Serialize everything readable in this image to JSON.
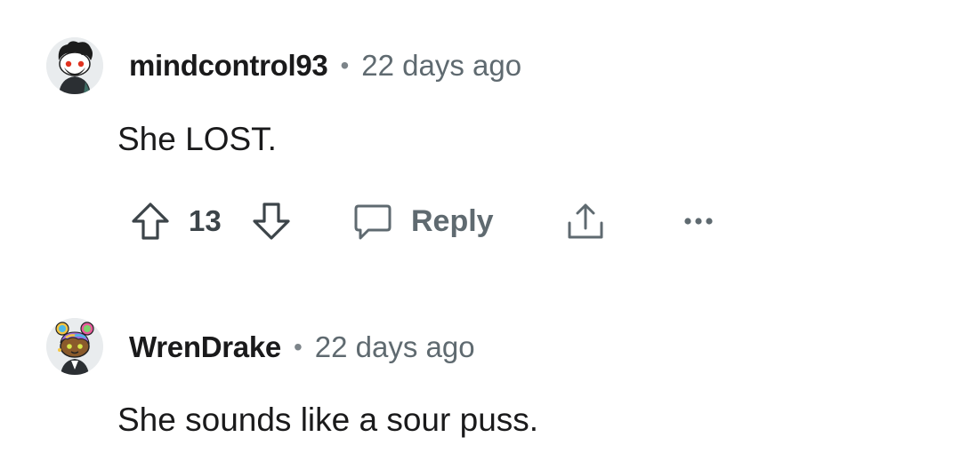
{
  "comments": [
    {
      "username": "mindcontrol93",
      "separator": "•",
      "timestamp": "22 days ago",
      "body": "She LOST.",
      "score": "13",
      "reply_label": "Reply",
      "avatar_icon": "snoo-avatar-icon"
    },
    {
      "username": "WrenDrake",
      "separator": "•",
      "timestamp": "22 days ago",
      "body": "She sounds like a sour puss.",
      "avatar_icon": "snoo-avatar-icon"
    }
  ],
  "icons": {
    "upvote": "upvote-arrow-icon",
    "downvote": "downvote-arrow-icon",
    "reply": "speech-bubble-icon",
    "share": "share-icon",
    "more": "more-options-icon"
  },
  "colors": {
    "text": "#1a1a1b",
    "muted": "#5f6a70",
    "background": "#ffffff"
  }
}
